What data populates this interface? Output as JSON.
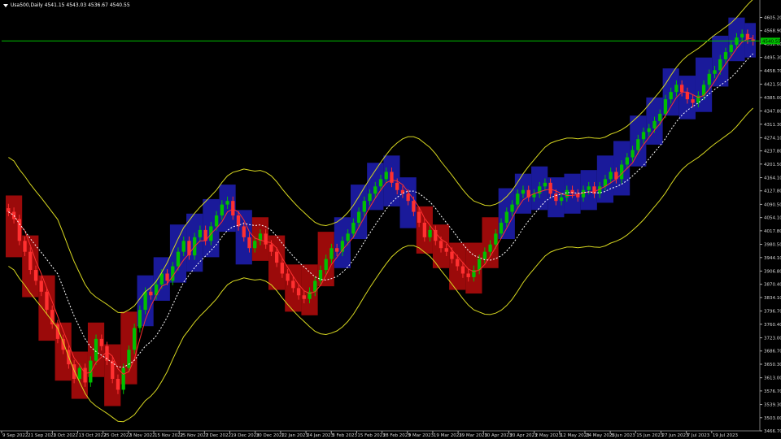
{
  "header": {
    "symbol": "Usa500,Daily",
    "ohlc": "4541.15 4543.03 4536.67 4540.55"
  },
  "price_marker": {
    "value": "4540.55",
    "color": "#00c000"
  },
  "colors": {
    "background": "#000000",
    "up_candle": "#00c000",
    "down_candle": "#ff3030",
    "bull_band": "#1a1a9a",
    "bear_band": "#9b0a0a",
    "envelope": "#d8d820",
    "fast_ma": "#ff3030",
    "slow_ma": "#ffffff",
    "axis_text": "#d8d8d8",
    "hline": "#00c000"
  },
  "chart_data": {
    "type": "candlestick",
    "y_ticks": [
      "4605.20",
      "4568.90",
      "4532.60",
      "4495.30",
      "4458.70",
      "4421.50",
      "4385.00",
      "4347.80",
      "4311.30",
      "4274.10",
      "4237.80",
      "4201.50",
      "4164.10",
      "4127.80",
      "4090.50",
      "4054.10",
      "4017.80",
      "3980.50",
      "3944.10",
      "3906.80",
      "3870.40",
      "3834.10",
      "3796.70",
      "3760.40",
      "3723.00",
      "3686.70",
      "3650.30",
      "3613.00",
      "3576.70",
      "3539.30",
      "3503.00",
      "3466.70"
    ],
    "y_range": [
      3466.7,
      4631
    ],
    "x_ticks": [
      "9 Sep 2022",
      "21 Sep 2022",
      "3 Oct 2022",
      "13 Oct 2022",
      "25 Oct 2022",
      "3 Nov 2022",
      "15 Nov 2022",
      "25 Nov 2022",
      "7 Dec 2022",
      "19 Dec 2022",
      "30 Dec 2022",
      "12 Jan 2023",
      "24 Jan 2023",
      "3 Feb 2023",
      "15 Feb 2023",
      "28 Feb 2023",
      "9 Mar 2023",
      "19 Mar 2023",
      "29 Mar 2023",
      "10 Apr 2023",
      "20 Apr 2023",
      "2 May 2023",
      "12 May 2023",
      "24 May 2023",
      "5 Jun 2023",
      "15 Jun 2023",
      "27 Jun 2023",
      "7 Jul 2023",
      "19 Jul 2023"
    ],
    "horizontal_line": 4540.55,
    "closes": [
      4070,
      4050,
      3990,
      3960,
      3910,
      3880,
      3850,
      3800,
      3760,
      3720,
      3690,
      3650,
      3610,
      3640,
      3600,
      3660,
      3720,
      3700,
      3660,
      3610,
      3580,
      3640,
      3690,
      3750,
      3800,
      3850,
      3840,
      3870,
      3900,
      3880,
      3920,
      3960,
      3990,
      3950,
      4000,
      4020,
      3990,
      4030,
      4060,
      4090,
      4100,
      4060,
      4030,
      4000,
      3970,
      3990,
      4010,
      3980,
      3960,
      3930,
      3900,
      3880,
      3860,
      3840,
      3830,
      3850,
      3880,
      3910,
      3940,
      3970,
      3960,
      3990,
      4010,
      4040,
      4070,
      4100,
      4120,
      4140,
      4160,
      4180,
      4150,
      4130,
      4120,
      4100,
      4070,
      4040,
      4000,
      4020,
      3990,
      3970,
      3960,
      3940,
      3920,
      3900,
      3890,
      3910,
      3940,
      3960,
      3980,
      4010,
      4040,
      4070,
      4090,
      4120,
      4130,
      4110,
      4120,
      4140,
      4150,
      4120,
      4100,
      4110,
      4130,
      4120,
      4110,
      4130,
      4140,
      4120,
      4140,
      4160,
      4180,
      4160,
      4200,
      4220,
      4240,
      4270,
      4290,
      4300,
      4320,
      4340,
      4380,
      4400,
      4420,
      4400,
      4380,
      4370,
      4390,
      4420,
      4450,
      4460,
      4490,
      4510,
      4530,
      4550,
      4560,
      4545,
      4540
    ],
    "series": [
      {
        "name": "Envelope",
        "style": "line"
      },
      {
        "name": "Fast MA",
        "style": "line"
      },
      {
        "name": "Slow MA",
        "style": "dotted"
      }
    ]
  }
}
